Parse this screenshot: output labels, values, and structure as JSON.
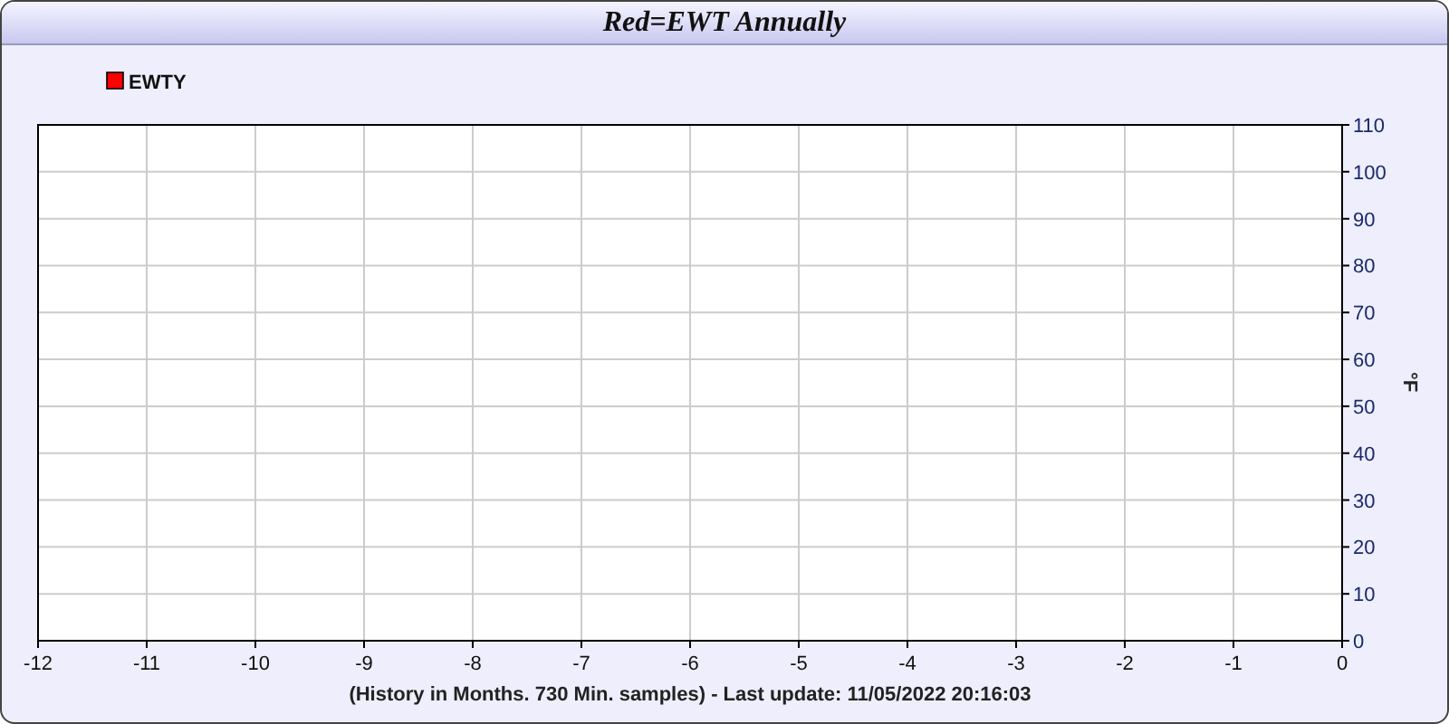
{
  "window": {
    "title": "Red=EWT Annually"
  },
  "chart": {
    "chart_data": {
      "type": "line",
      "xlabel": "(History in Months. 730 Min. samples) - Last update: 11/05/2022 20:16:03",
      "ylabel": "°F",
      "categories": [
        "-12",
        "-11",
        "-10",
        "-9",
        "-8",
        "-7",
        "-6",
        "-5",
        "-4",
        "-3",
        "-2",
        "-1",
        "0"
      ],
      "series": [
        {
          "name": "EWTY",
          "color": "#ff0000",
          "values": [
            null,
            null,
            null,
            null,
            null,
            null,
            null,
            null,
            null,
            null,
            null,
            null,
            null
          ]
        }
      ],
      "ylim": [
        0,
        110
      ],
      "yticks": [
        0,
        10,
        20,
        30,
        40,
        50,
        60,
        70,
        80,
        90,
        100,
        110
      ],
      "grid": true
    }
  }
}
